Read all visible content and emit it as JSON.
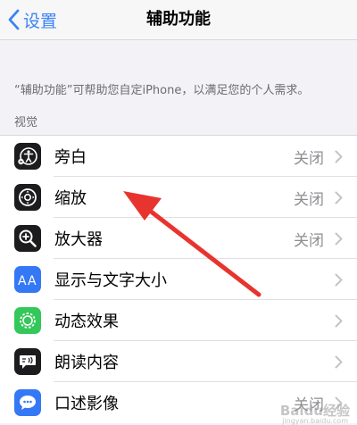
{
  "nav": {
    "back_label": "设置",
    "title": "辅助功能"
  },
  "description": "“辅助功能”可帮助您自定iPhone，以满足您的个人需求。",
  "section_header": "视觉",
  "rows": [
    {
      "label": "旁白",
      "value": "关闭",
      "icon": "voiceover-icon",
      "icon_bg": "#1c1c1e"
    },
    {
      "label": "缩放",
      "value": "关闭",
      "icon": "zoom-icon",
      "icon_bg": "#1c1c1e"
    },
    {
      "label": "放大器",
      "value": "关闭",
      "icon": "magnifier-icon",
      "icon_bg": "#1c1c1e"
    },
    {
      "label": "显示与文字大小",
      "value": "",
      "icon": "text-size-icon",
      "icon_bg": "#3478f6"
    },
    {
      "label": "动态效果",
      "value": "",
      "icon": "motion-icon",
      "icon_bg": "#34c759"
    },
    {
      "label": "朗读内容",
      "value": "",
      "icon": "spoken-content-icon",
      "icon_bg": "#1c1c1e"
    },
    {
      "label": "口述影像",
      "value": "关闭",
      "icon": "audio-description-icon",
      "icon_bg": "#3478f6"
    }
  ],
  "watermark": "Baidu经验",
  "watermark_sub": "jingyan.baidu.com",
  "colors": {
    "accent": "#3a82f7",
    "annotation_arrow": "#e8342e"
  }
}
